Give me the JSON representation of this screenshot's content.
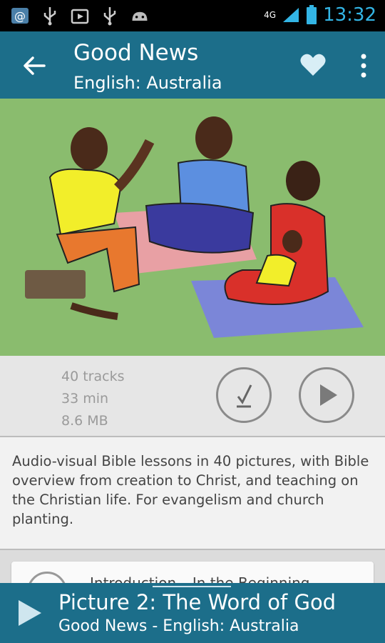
{
  "status": {
    "network": "4G",
    "time": "13:32"
  },
  "appbar": {
    "title": "Good News",
    "subtitle": "English: Australia"
  },
  "hero": {
    "alt": "illustration"
  },
  "meta": {
    "tracks": "40 tracks",
    "duration": "33 min",
    "size": "8.6 MB"
  },
  "description": "Audio-visual Bible lessons in 40 pictures, with Bible overview from creation to Christ, and teaching on the Christian life. For evangelism and church planting.",
  "list": {
    "first_item": "Introduction – In the Beginning"
  },
  "player": {
    "title": "Picture 2: The Word of God",
    "subtitle": "Good News - English: Australia"
  },
  "colors": {
    "appbar": "#1c6e8a",
    "status_clock": "#33b5e5",
    "hero_bg": "#8abc6e"
  }
}
